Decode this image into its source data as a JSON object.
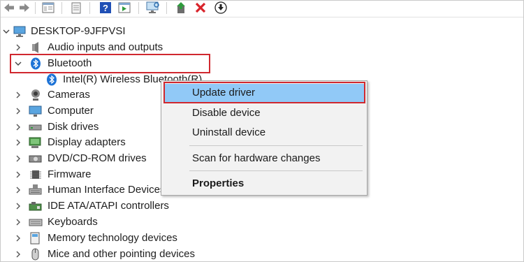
{
  "toolbar": {
    "buttons": [
      {
        "name": "back-arrow-icon"
      },
      {
        "name": "forward-arrow-icon"
      },
      {
        "name": "device-properties-icon"
      },
      {
        "name": "device-list-icon"
      },
      {
        "name": "help-icon"
      },
      {
        "name": "run-icon"
      },
      {
        "name": "scan-monitor-icon"
      },
      {
        "name": "update-driver-icon"
      },
      {
        "name": "uninstall-x-icon"
      },
      {
        "name": "download-icon"
      }
    ],
    "colors": {
      "help": "#1f4fb5",
      "uninstall": "#d8232a",
      "green": "#2e9b3c"
    }
  },
  "tree": {
    "root": "DESKTOP-9JFPVSI",
    "items": [
      {
        "label": "Audio inputs and outputs",
        "icon": "speaker-icon"
      },
      {
        "label": "Bluetooth",
        "icon": "bluetooth-icon",
        "expanded": true
      },
      {
        "label": "Intel(R) Wireless Bluetooth(R)",
        "icon": "bluetooth-icon",
        "child": true
      },
      {
        "label": "Cameras",
        "icon": "camera-icon"
      },
      {
        "label": "Computer",
        "icon": "computer-icon"
      },
      {
        "label": "Disk drives",
        "icon": "disk-drive-icon"
      },
      {
        "label": "Display adapters",
        "icon": "display-adapter-icon"
      },
      {
        "label": "DVD/CD-ROM drives",
        "icon": "dvd-drive-icon"
      },
      {
        "label": "Firmware",
        "icon": "firmware-icon"
      },
      {
        "label": "Human Interface Devices",
        "icon": "hid-icon"
      },
      {
        "label": "IDE ATA/ATAPI controllers",
        "icon": "ide-controller-icon"
      },
      {
        "label": "Keyboards",
        "icon": "keyboard-icon"
      },
      {
        "label": "Memory technology devices",
        "icon": "memory-icon"
      },
      {
        "label": "Mice and other pointing devices",
        "icon": "mouse-icon"
      }
    ]
  },
  "context_menu": {
    "items": [
      {
        "label": "Update driver",
        "selected": true
      },
      {
        "label": "Disable device"
      },
      {
        "label": "Uninstall device"
      },
      {
        "label": "Scan for hardware changes"
      },
      {
        "label": "Properties",
        "bold": true
      }
    ]
  },
  "colors": {
    "highlight_border": "#d0282f",
    "menu_selection": "#91c9f7",
    "bluetooth": "#1e73d6"
  }
}
